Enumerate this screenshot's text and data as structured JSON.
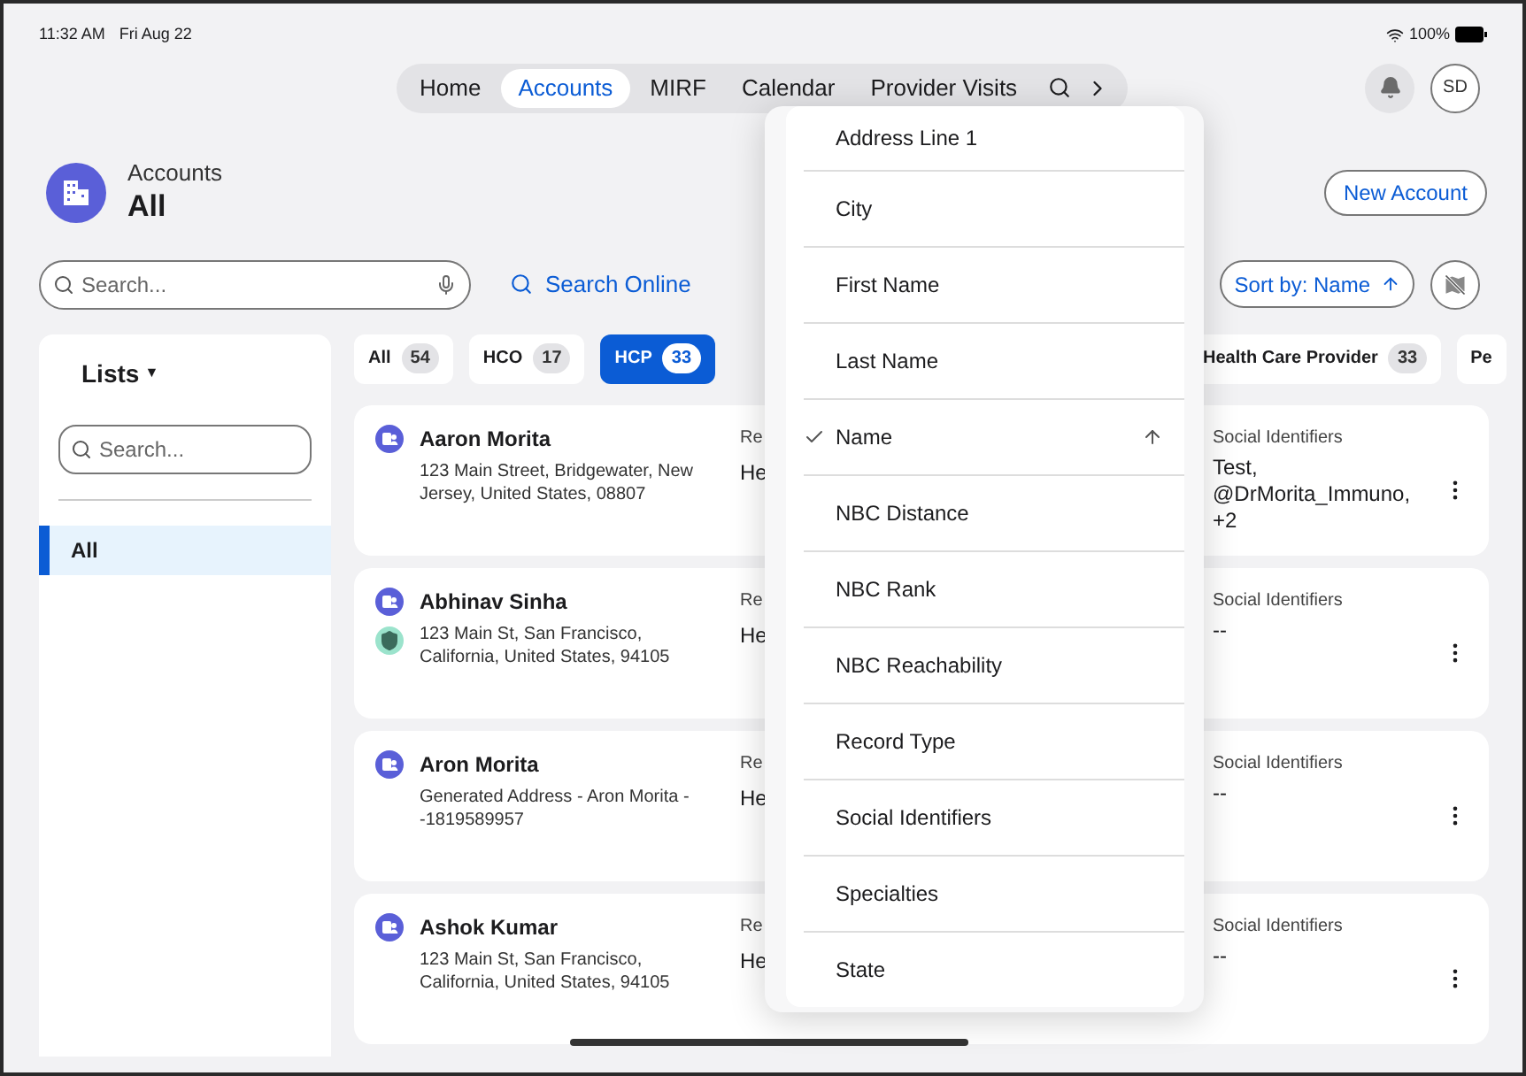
{
  "status_bar": {
    "time": "11:32 AM",
    "date": "Fri Aug 22",
    "battery": "100%"
  },
  "nav": {
    "tabs": [
      {
        "label": "Home",
        "selected": false
      },
      {
        "label": "Accounts",
        "selected": true
      },
      {
        "label": "MIRF",
        "selected": false
      },
      {
        "label": "Calendar",
        "selected": false
      },
      {
        "label": "Provider Visits",
        "selected": false
      }
    ],
    "avatar": "SD"
  },
  "header": {
    "title": "Accounts",
    "subtitle": "All",
    "new_button": "New Account"
  },
  "search": {
    "placeholder": "Search...",
    "online": "Search Online",
    "sort": "Sort by: Name",
    "ascending": true
  },
  "lists": {
    "title": "Lists",
    "caret": "▼",
    "search_placeholder": "Search...",
    "items": [
      {
        "label": "All",
        "selected": true
      }
    ]
  },
  "filters": [
    {
      "label": "All",
      "count": "54",
      "selected": false
    },
    {
      "label": "HCO",
      "count": "17",
      "selected": false
    },
    {
      "label": "HCP",
      "count": "33",
      "selected": true
    },
    {
      "label": "Health Care Provider",
      "count": "33",
      "selected": false
    },
    {
      "label": "Pe",
      "selected": false
    }
  ],
  "accounts": [
    {
      "name": "Aaron Morita",
      "address": "123 Main Street, Bridgewater, New Jersey, United States, 08807",
      "verified": false,
      "column_3_label": "Re",
      "column_3_value": "He",
      "social_label": "Social Identifiers",
      "social_value": "Test, @DrMorita_Immuno, +2"
    },
    {
      "name": "Abhinav Sinha",
      "address": "123 Main St, San Francisco, California, United States, 94105",
      "verified": true,
      "column_3_label": "Re",
      "column_3_value": "He",
      "social_label": "Social Identifiers",
      "social_value": "--"
    },
    {
      "name": "Aron Morita",
      "address": "Generated Address - Aron Morita - -1819589957",
      "verified": false,
      "column_3_label": "Re",
      "column_3_value": "He",
      "social_label": "Social Identifiers",
      "social_value": "--"
    },
    {
      "name": "Ashok Kumar",
      "address": "123 Main St, San Francisco, California, United States, 94105",
      "verified": false,
      "column_3_label": "Re",
      "column_3_value": "He",
      "social_label": "Social Identifiers",
      "social_value": "--"
    }
  ],
  "sort_menu": {
    "items": [
      {
        "label": "Address Line 1",
        "selected": false
      },
      {
        "label": "City",
        "selected": false
      },
      {
        "label": "First Name",
        "selected": false
      },
      {
        "label": "Last Name",
        "selected": false
      },
      {
        "label": "Name",
        "selected": true
      },
      {
        "label": "NBC Distance",
        "selected": false
      },
      {
        "label": "NBC Rank",
        "selected": false
      },
      {
        "label": "NBC Reachability",
        "selected": false
      },
      {
        "label": "Record Type",
        "selected": false
      },
      {
        "label": "Social Identifiers",
        "selected": false
      },
      {
        "label": "Specialties",
        "selected": false
      },
      {
        "label": "State",
        "selected": false
      }
    ]
  }
}
